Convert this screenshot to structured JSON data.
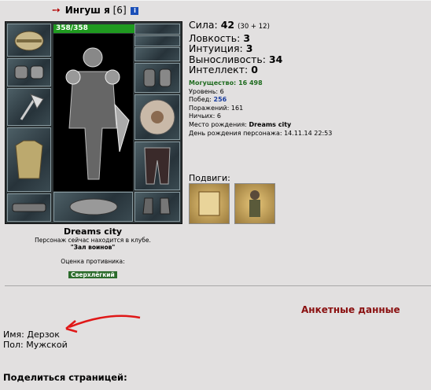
{
  "header": {
    "name": "Ингуш я",
    "level": "[6]",
    "info_icon": "info-icon",
    "arrow_icon": "arrow-icon"
  },
  "hp": "358/358",
  "stats": {
    "strength_label": "Сила:",
    "strength": "42",
    "strength_extra": "(30 + 12)",
    "agility_label": "Ловкость:",
    "agility": "3",
    "intuition_label": "Интуиция:",
    "intuition": "3",
    "endurance_label": "Выносливость:",
    "endurance": "34",
    "intellect_label": "Интеллект:",
    "intellect": "0"
  },
  "info": {
    "power_label": "Могущество:",
    "power": "16 498",
    "level_label": "Уровень:",
    "level": "6",
    "wins_label": "Побед:",
    "wins": "256",
    "losses_label": "Поражений:",
    "losses": "161",
    "draws_label": "Ничьих:",
    "draws": "6",
    "birthplace_label": "Место рождения:",
    "birthplace": "Dreams city",
    "birthday_label": "День рождения персонажа:",
    "birthday": "14.11.14 22:53"
  },
  "feats_label": "Подвиги:",
  "club": {
    "city": "Dreams city",
    "status": "Персонаж сейчас находится в клубе.",
    "room": "\"Зал воинов\"",
    "rating_label": "Оценка противника:",
    "rating": "Сверхлёгкий"
  },
  "anket_title": "Анкетные данные",
  "fields": {
    "name": "Имя: Дерзок",
    "gender": "Пол: Мужской"
  },
  "share_label": "Поделиться страницей:",
  "colors": {
    "hp": "#1f9a1f",
    "title_red": "#8a1010",
    "annotation_red": "#e01818"
  }
}
